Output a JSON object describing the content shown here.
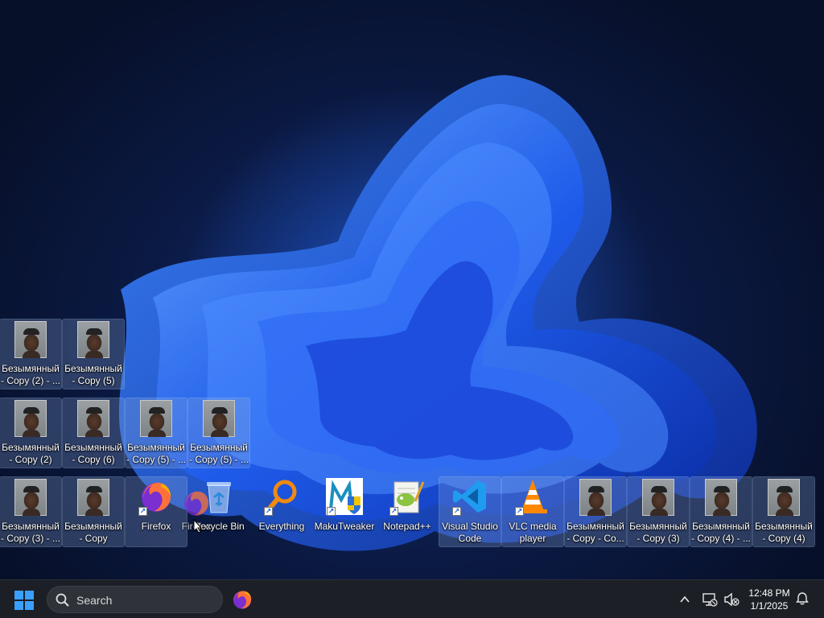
{
  "desktop": {
    "icons": [
      {
        "label": "Безымянный - Copy (2) - ...",
        "kind": "photo",
        "selected": true
      },
      {
        "label": "Безымянный - Copy (5)",
        "kind": "photo",
        "selected": true
      },
      {
        "label": "Безымянный - Copy (2)",
        "kind": "photo",
        "selected": true
      },
      {
        "label": "Безымянный - Copy (6)",
        "kind": "photo",
        "selected": true
      },
      {
        "label": "Безымянный - Copy (5) - ...",
        "kind": "photo",
        "selected": true
      },
      {
        "label": "Безымянный - Copy (5) - ...",
        "kind": "photo",
        "selected": true
      },
      {
        "label": "Безымянный - Copy (3) - ...",
        "kind": "photo",
        "selected": true
      },
      {
        "label": "Безымянный - Copy",
        "kind": "photo",
        "selected": true
      },
      {
        "label": "Firefox",
        "kind": "firefox",
        "selected": true
      },
      {
        "label": "Recycle Bin",
        "kind": "recycle-bin",
        "selected": false
      },
      {
        "label": "Everything",
        "kind": "everything",
        "selected": false
      },
      {
        "label": "MakuTweaker",
        "kind": "makutweaker",
        "selected": false
      },
      {
        "label": "Notepad++",
        "kind": "notepadpp",
        "selected": false
      },
      {
        "label": "Visual Studio Code",
        "kind": "vscode",
        "selected": true
      },
      {
        "label": "VLC media player",
        "kind": "vlc",
        "selected": true
      },
      {
        "label": "Безымянный - Copy - Co...",
        "kind": "photo",
        "selected": true
      },
      {
        "label": "Безымянный - Copy (3)",
        "kind": "photo",
        "selected": true
      },
      {
        "label": "Безымянный - Copy (4) - ...",
        "kind": "photo",
        "selected": true
      },
      {
        "label": "Безымянный - Copy (4)",
        "kind": "photo",
        "selected": true
      }
    ],
    "drag_ghost": {
      "label": "Firefox",
      "kind": "firefox"
    }
  },
  "taskbar": {
    "start_icon": "windows-logo-icon",
    "search": {
      "placeholder": "Search",
      "icon": "search-icon"
    },
    "pinned": [
      {
        "name": "Firefox",
        "icon": "firefox-icon"
      }
    ],
    "tray": {
      "chevron_icon": "chevron-up-icon",
      "network_icon": "network-disconnected-icon",
      "volume_icon": "volume-muted-icon",
      "time": "12:48 PM",
      "date": "1/1/2025",
      "notification_icon": "bell-icon"
    }
  },
  "colors": {
    "accent": "#0a5cff",
    "taskbar": "#1c2026",
    "selection": "#8caadc"
  }
}
